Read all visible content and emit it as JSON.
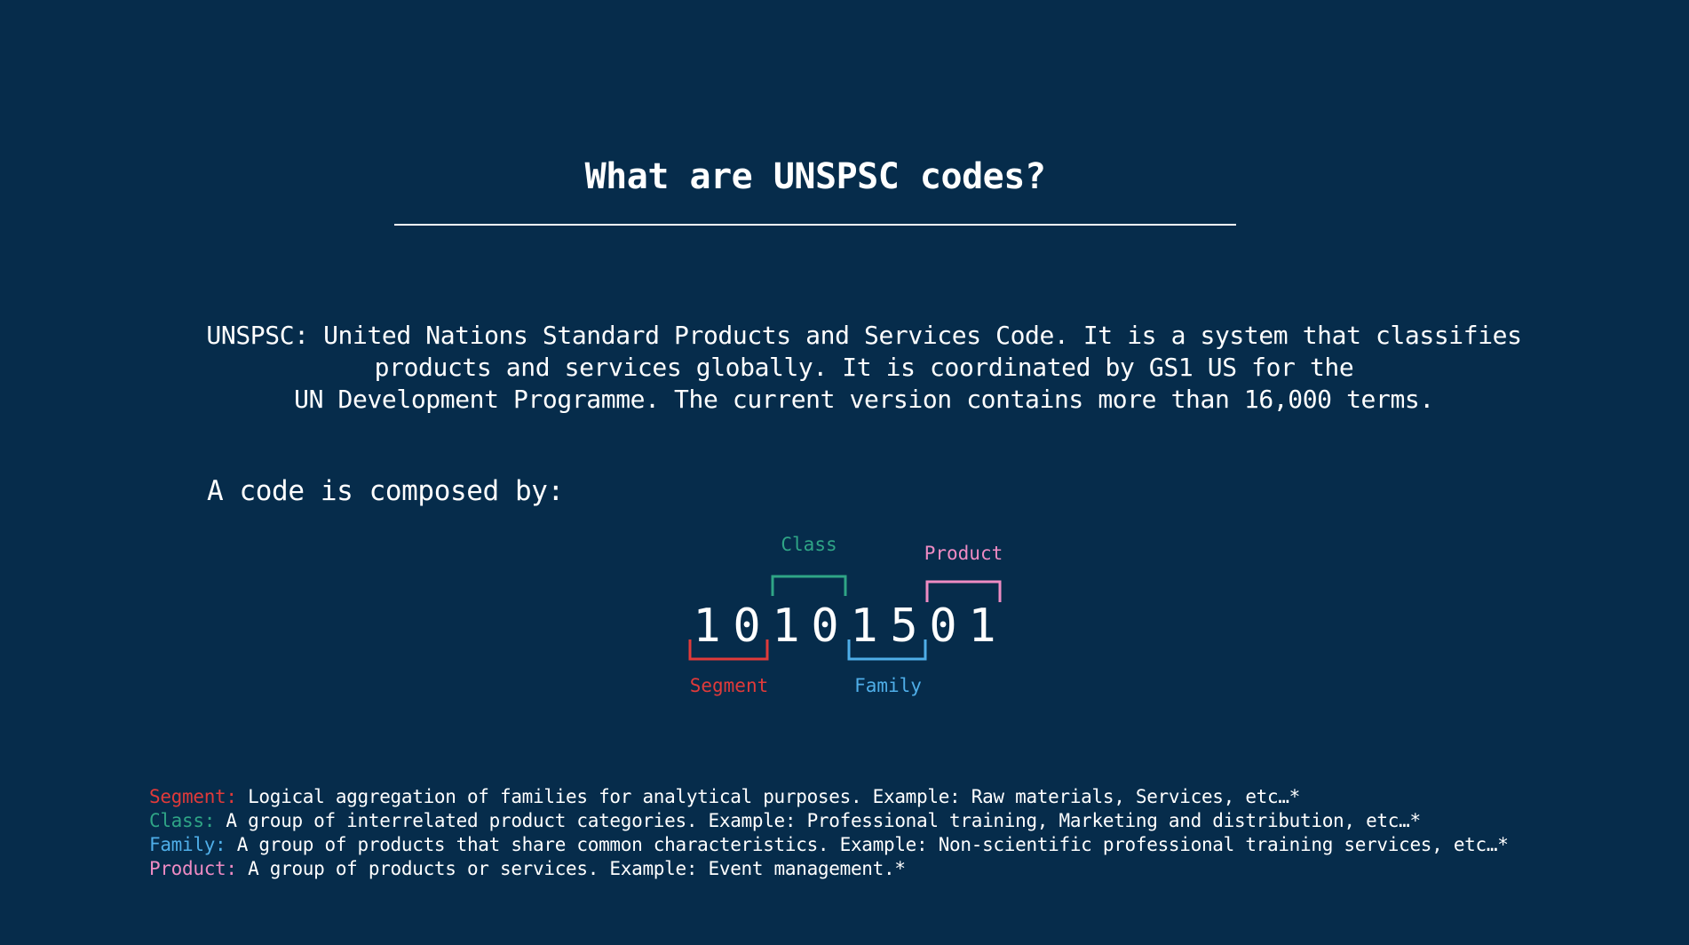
{
  "title": "What are UNSPSC codes?",
  "intro": {
    "line1": "UNSPSC: United Nations Standard Products and Services Code. It is a system that classifies",
    "line2": "products and services globally. It is coordinated by GS1 US for the",
    "line3": "UN Development Programme. The current version contains more than 16,000 terms."
  },
  "composed_heading": "A code is composed by:",
  "code": {
    "digits": [
      "1",
      "0",
      "1",
      "0",
      "1",
      "5",
      "0",
      "1"
    ],
    "labels": {
      "segment": "Segment",
      "class": "Class",
      "family": "Family",
      "product": "Product"
    }
  },
  "legend": [
    {
      "term": "Segment:",
      "text": "Logical aggregation of families for analytical purposes. Example: Raw materials, Services, etc…*"
    },
    {
      "term": "Class:",
      "text": "A group of interrelated product categories. Example: Professional training, Marketing and distribution, etc…*"
    },
    {
      "term": "Family:",
      "text": "A group of products that share common characteristics. Example: Non-scientific professional training services, etc…*"
    },
    {
      "term": "Product:",
      "text": "A group of products or services. Example: Event management.*"
    }
  ],
  "colors": {
    "background": "#062c4b",
    "text": "#ffffff",
    "segment": "#e03a3a",
    "class": "#2fa586",
    "family": "#4faee8",
    "product": "#ee8bc3"
  }
}
